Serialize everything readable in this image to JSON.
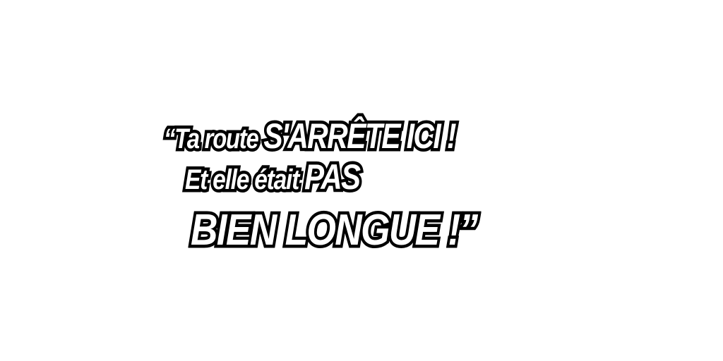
{
  "quote": {
    "line1": {
      "part1": "“Ta route ",
      "part2": "S'ARRÊTE ICI !"
    },
    "line2": {
      "part1": "Et elle était ",
      "part2": "PAS"
    },
    "line3": "BIEN LONGUE !”"
  },
  "colors": {
    "text_fill": "#ffffff",
    "text_outline": "#000000",
    "background": "#ffffff"
  }
}
